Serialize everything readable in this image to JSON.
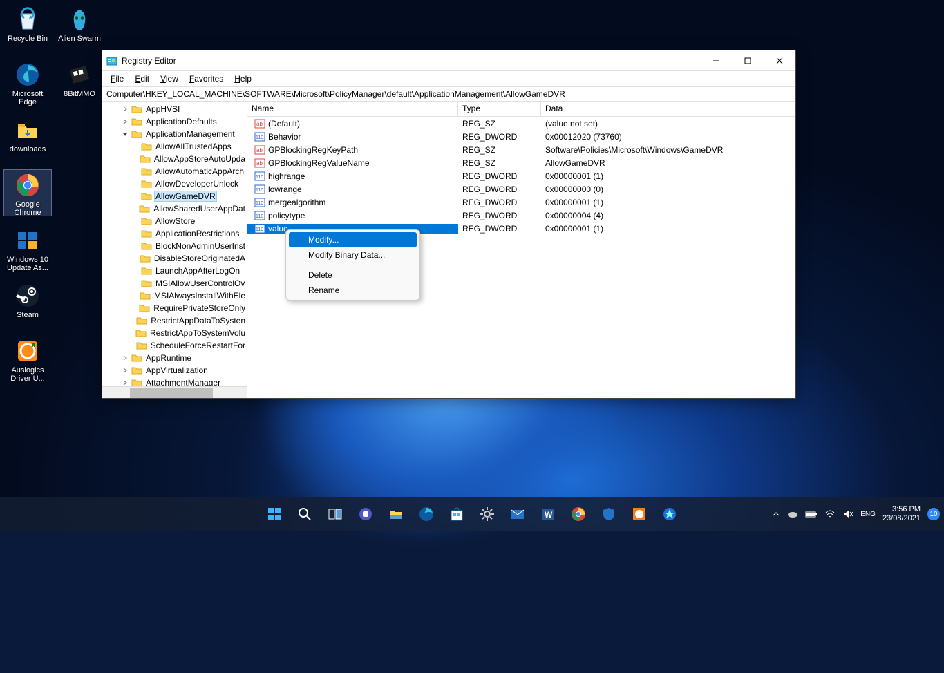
{
  "desktop": {
    "icons_col1": [
      {
        "name": "recycle-bin",
        "label": "Recycle Bin"
      },
      {
        "name": "microsoft-edge",
        "label": "Microsoft Edge"
      },
      {
        "name": "downloads-folder",
        "label": "downloads"
      },
      {
        "name": "google-chrome",
        "label": "Google Chrome",
        "selected": true
      },
      {
        "name": "windows-10-update",
        "label": "Windows 10 Update As..."
      },
      {
        "name": "steam",
        "label": "Steam"
      },
      {
        "name": "auslogics",
        "label": "Auslogics Driver U..."
      }
    ],
    "icons_col2": [
      {
        "name": "alien-swarm",
        "label": "Alien Swarm"
      },
      {
        "name": "8bitmmo",
        "label": "8BitMMO"
      }
    ]
  },
  "window": {
    "title": "Registry Editor",
    "menubar": [
      "File",
      "Edit",
      "View",
      "Favorites",
      "Help"
    ],
    "address": "Computer\\HKEY_LOCAL_MACHINE\\SOFTWARE\\Microsoft\\PolicyManager\\default\\ApplicationManagement\\AllowGameDVR",
    "tree": [
      {
        "label": "AppHVSI",
        "indent": 2,
        "exp": ">"
      },
      {
        "label": "ApplicationDefaults",
        "indent": 2,
        "exp": ">"
      },
      {
        "label": "ApplicationManagement",
        "indent": 2,
        "exp": "v"
      },
      {
        "label": "AllowAllTrustedApps",
        "indent": 3,
        "exp": ""
      },
      {
        "label": "AllowAppStoreAutoUpda",
        "indent": 3,
        "exp": ""
      },
      {
        "label": "AllowAutomaticAppArch",
        "indent": 3,
        "exp": ""
      },
      {
        "label": "AllowDeveloperUnlock",
        "indent": 3,
        "exp": ""
      },
      {
        "label": "AllowGameDVR",
        "indent": 3,
        "exp": "",
        "selected": true
      },
      {
        "label": "AllowSharedUserAppDat",
        "indent": 3,
        "exp": ""
      },
      {
        "label": "AllowStore",
        "indent": 3,
        "exp": ""
      },
      {
        "label": "ApplicationRestrictions",
        "indent": 3,
        "exp": ""
      },
      {
        "label": "BlockNonAdminUserInst",
        "indent": 3,
        "exp": ""
      },
      {
        "label": "DisableStoreOriginatedA",
        "indent": 3,
        "exp": ""
      },
      {
        "label": "LaunchAppAfterLogOn",
        "indent": 3,
        "exp": ""
      },
      {
        "label": "MSIAllowUserControlOv",
        "indent": 3,
        "exp": ""
      },
      {
        "label": "MSIAlwaysInstallWithEle",
        "indent": 3,
        "exp": ""
      },
      {
        "label": "RequirePrivateStoreOnly",
        "indent": 3,
        "exp": ""
      },
      {
        "label": "RestrictAppDataToSysten",
        "indent": 3,
        "exp": ""
      },
      {
        "label": "RestrictAppToSystemVolu",
        "indent": 3,
        "exp": ""
      },
      {
        "label": "ScheduleForceRestartFor",
        "indent": 3,
        "exp": ""
      },
      {
        "label": "AppRuntime",
        "indent": 2,
        "exp": ">"
      },
      {
        "label": "AppVirtualization",
        "indent": 2,
        "exp": ">"
      },
      {
        "label": "AttachmentManager",
        "indent": 2,
        "exp": ">"
      }
    ],
    "columns": {
      "name": "Name",
      "type": "Type",
      "data": "Data"
    },
    "values": [
      {
        "name": "(Default)",
        "type": "REG_SZ",
        "data": "(value not set)",
        "vtype": "sz"
      },
      {
        "name": "Behavior",
        "type": "REG_DWORD",
        "data": "0x00012020 (73760)",
        "vtype": "dw"
      },
      {
        "name": "GPBlockingRegKeyPath",
        "type": "REG_SZ",
        "data": "Software\\Policies\\Microsoft\\Windows\\GameDVR",
        "vtype": "sz"
      },
      {
        "name": "GPBlockingRegValueName",
        "type": "REG_SZ",
        "data": "AllowGameDVR",
        "vtype": "sz"
      },
      {
        "name": "highrange",
        "type": "REG_DWORD",
        "data": "0x00000001 (1)",
        "vtype": "dw"
      },
      {
        "name": "lowrange",
        "type": "REG_DWORD",
        "data": "0x00000000 (0)",
        "vtype": "dw"
      },
      {
        "name": "mergealgorithm",
        "type": "REG_DWORD",
        "data": "0x00000001 (1)",
        "vtype": "dw"
      },
      {
        "name": "policytype",
        "type": "REG_DWORD",
        "data": "0x00000004 (4)",
        "vtype": "dw"
      },
      {
        "name": "value",
        "type": "REG_DWORD",
        "data": "0x00000001 (1)",
        "vtype": "dw",
        "selected": true
      }
    ]
  },
  "contextmenu": {
    "items": [
      {
        "label": "Modify...",
        "hover": true
      },
      {
        "label": "Modify Binary Data..."
      },
      {
        "sep": true
      },
      {
        "label": "Delete"
      },
      {
        "label": "Rename"
      }
    ]
  },
  "taskbar": {
    "apps": [
      "start",
      "search",
      "taskview",
      "chat",
      "explorer",
      "edge",
      "store",
      "settings",
      "mail",
      "word",
      "chrome",
      "security",
      "app1",
      "app2"
    ],
    "tray": {
      "time": "3:56 PM",
      "date": "23/08/2021",
      "badge": "10"
    }
  }
}
